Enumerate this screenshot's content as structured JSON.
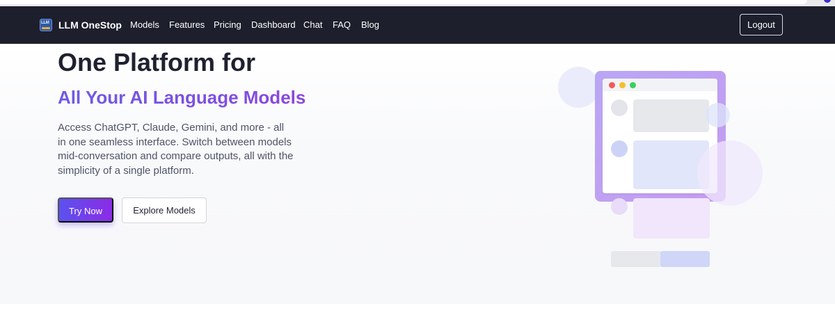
{
  "navbar": {
    "brand": "LLM OneStop",
    "logo_text": "LLM",
    "links": [
      {
        "label": "Models"
      },
      {
        "label": "Features"
      },
      {
        "label": "Pricing"
      },
      {
        "label": "Dashboard"
      },
      {
        "label": "Chat"
      },
      {
        "label": "FAQ"
      },
      {
        "label": "Blog"
      }
    ],
    "logout_label": "Logout"
  },
  "hero": {
    "title_line1": "One Platform for",
    "title_line2": "All Your AI Language Models",
    "description": "Access ChatGPT, Claude, Gemini, and more - all in one seamless interface. Switch between models mid-conversation and compare outputs, all with the simplicity of a single platform.",
    "primary_button": "Try Now",
    "secondary_button": "Explore Models"
  },
  "colors": {
    "navbar_bg": "#1d1f2c",
    "accent_start": "#5b52ef",
    "accent_end": "#8b2be6",
    "title_gradient_start": "#6c5be6",
    "title_gradient_end": "#8a47de",
    "window_dot_red": "#ef5b5b",
    "window_dot_yellow": "#f4bf2a",
    "window_dot_green": "#3ccf5e"
  },
  "icons": {
    "logo": "llm-logo-icon"
  }
}
